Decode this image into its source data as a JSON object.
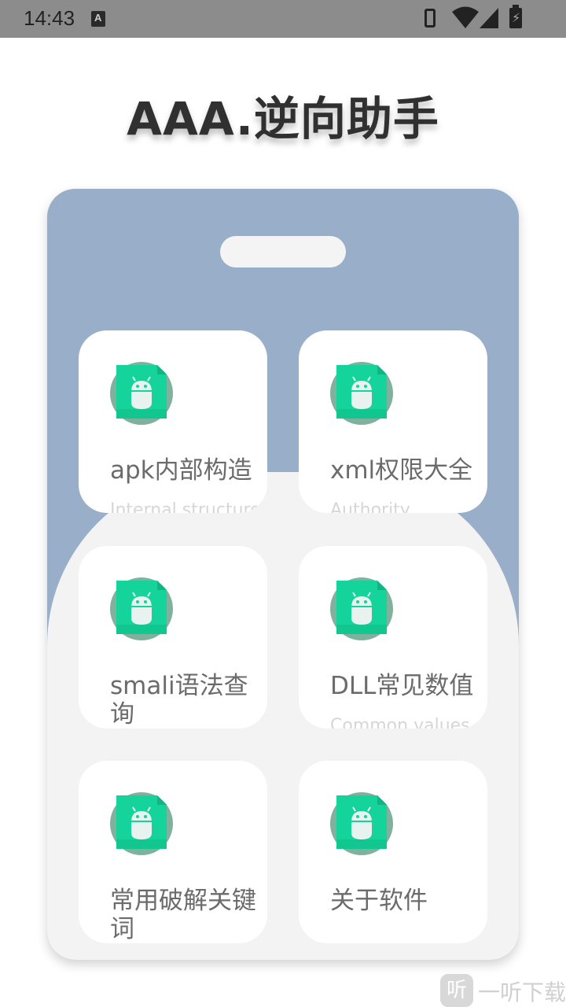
{
  "status_bar": {
    "time": "14:43",
    "a_badge": "A"
  },
  "header": {
    "title": "AAA.逆向助手"
  },
  "tiles": [
    {
      "title": "apk内部构造",
      "subtitle": "Internal structure",
      "icon": "android-icon"
    },
    {
      "title": "xml权限大全",
      "subtitle": "Authority",
      "icon": "android-icon"
    },
    {
      "title": "smali语法查询",
      "subtitle": "",
      "icon": "android-icon"
    },
    {
      "title": "DLL常见数值",
      "subtitle": "Common values",
      "icon": "android-icon"
    },
    {
      "title": "常用破解关键词",
      "subtitle": "",
      "icon": "android-icon"
    },
    {
      "title": "关于软件",
      "subtitle": "",
      "icon": "android-icon"
    }
  ],
  "watermark": {
    "icon_glyph": "听",
    "text": "一听下载"
  },
  "colors": {
    "panel_top": "#99aec8",
    "panel_bottom": "#f3f3f3",
    "icon_green": "#14d49b",
    "icon_ring": "#7fb19d"
  }
}
